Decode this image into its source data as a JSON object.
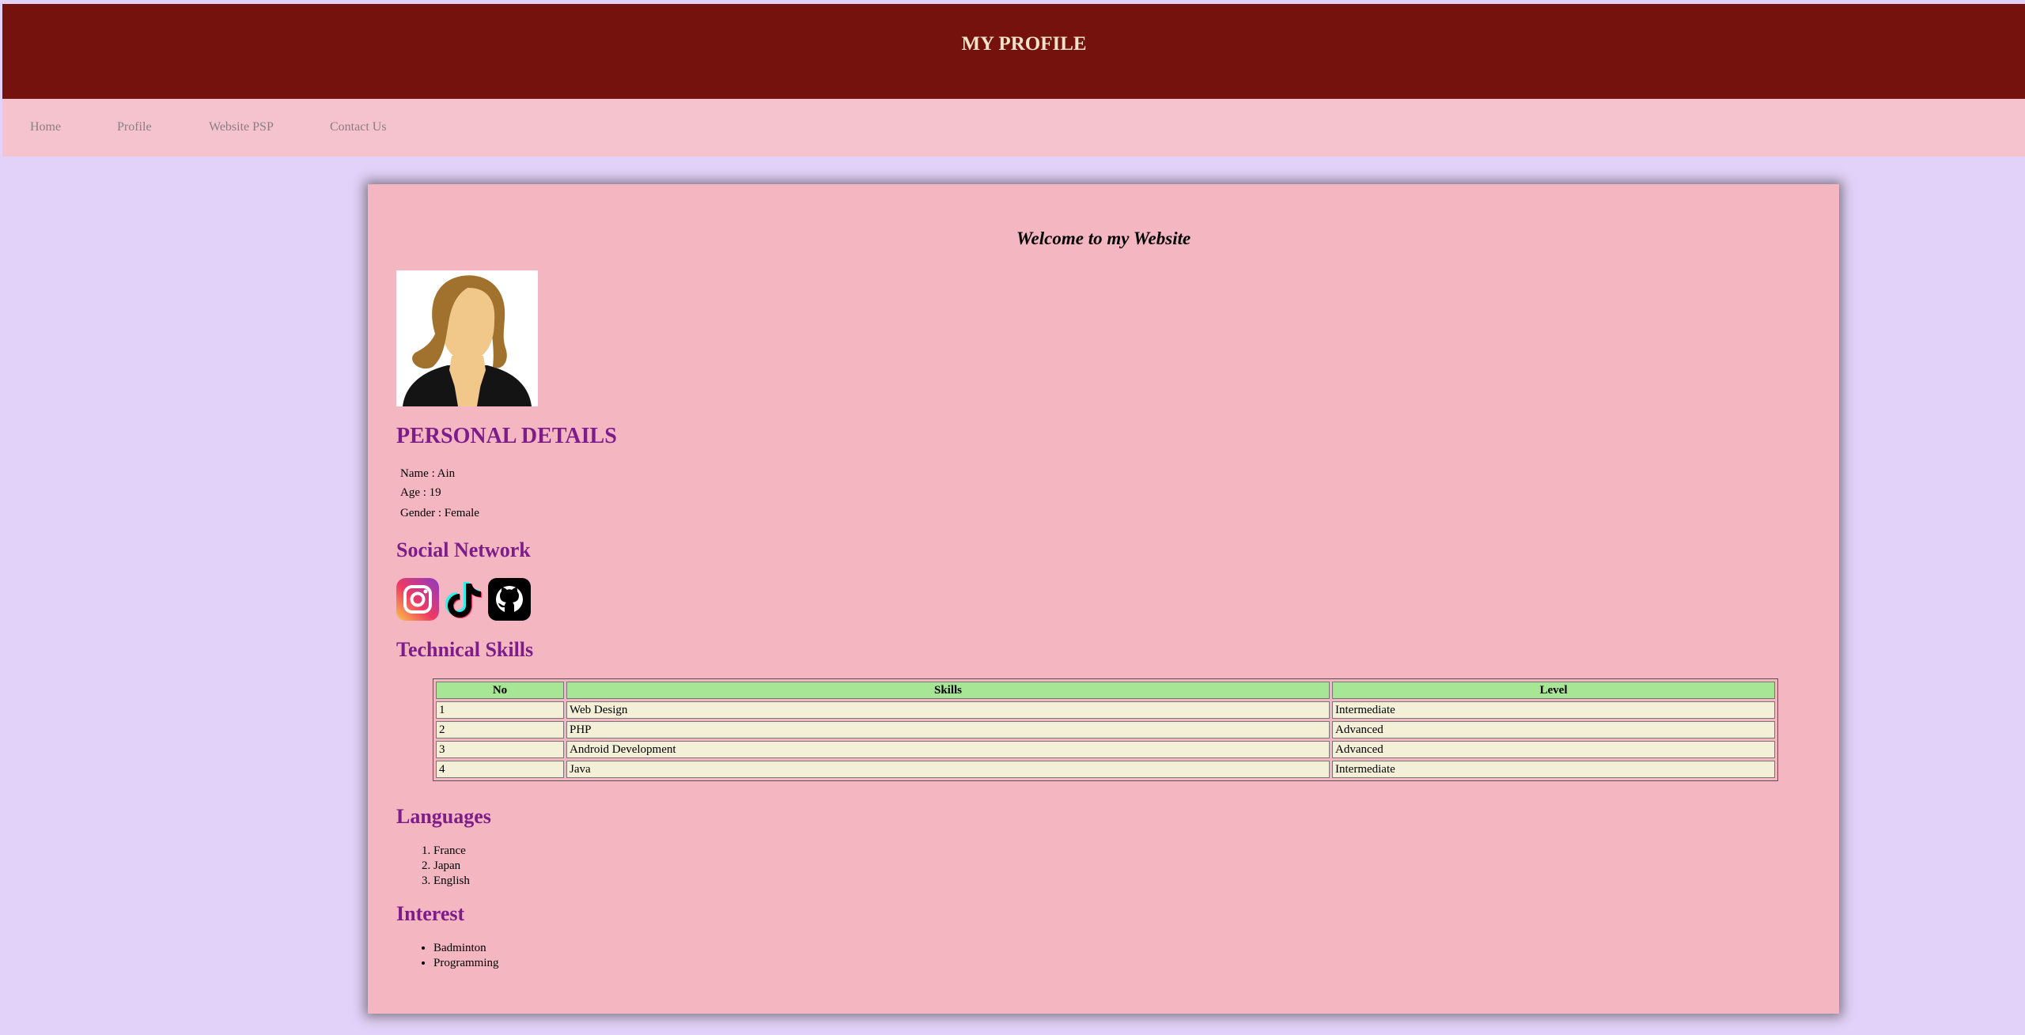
{
  "header": {
    "title": "MY PROFILE"
  },
  "nav": {
    "items": [
      "Home",
      "Profile",
      "Website PSP",
      "Contact Us"
    ]
  },
  "main": {
    "welcome": "Welcome to my Website",
    "personal_heading": "PERSONAL DETAILS",
    "details": [
      "Name : Ain",
      "Age : 19",
      "Gender : Female"
    ],
    "social_heading": "Social Network",
    "social_icons": [
      "instagram-icon",
      "tiktok-icon",
      "github-icon"
    ],
    "skills_heading": "Technical Skills",
    "skills_table": {
      "headers": [
        "No",
        "Skills",
        "Level"
      ],
      "rows": [
        [
          "1",
          "Web Design",
          "Intermediate"
        ],
        [
          "2",
          "PHP",
          "Advanced"
        ],
        [
          "3",
          "Android Development",
          "Advanced"
        ],
        [
          "4",
          "Java",
          "Intermediate"
        ]
      ]
    },
    "languages_heading": "Languages",
    "languages": [
      "France",
      "Japan",
      "English"
    ],
    "interest_heading": "Interest",
    "interests": [
      "Badminton",
      "Programming"
    ]
  },
  "colors": {
    "header_bg": "#75120d",
    "nav_bg": "#f4c3ce",
    "page_bg": "#e2d1f8",
    "panel_bg": "#f4b6c0",
    "heading": "#7d1d8a",
    "table_header": "#a6e695",
    "table_cell": "#f4f0d8"
  }
}
